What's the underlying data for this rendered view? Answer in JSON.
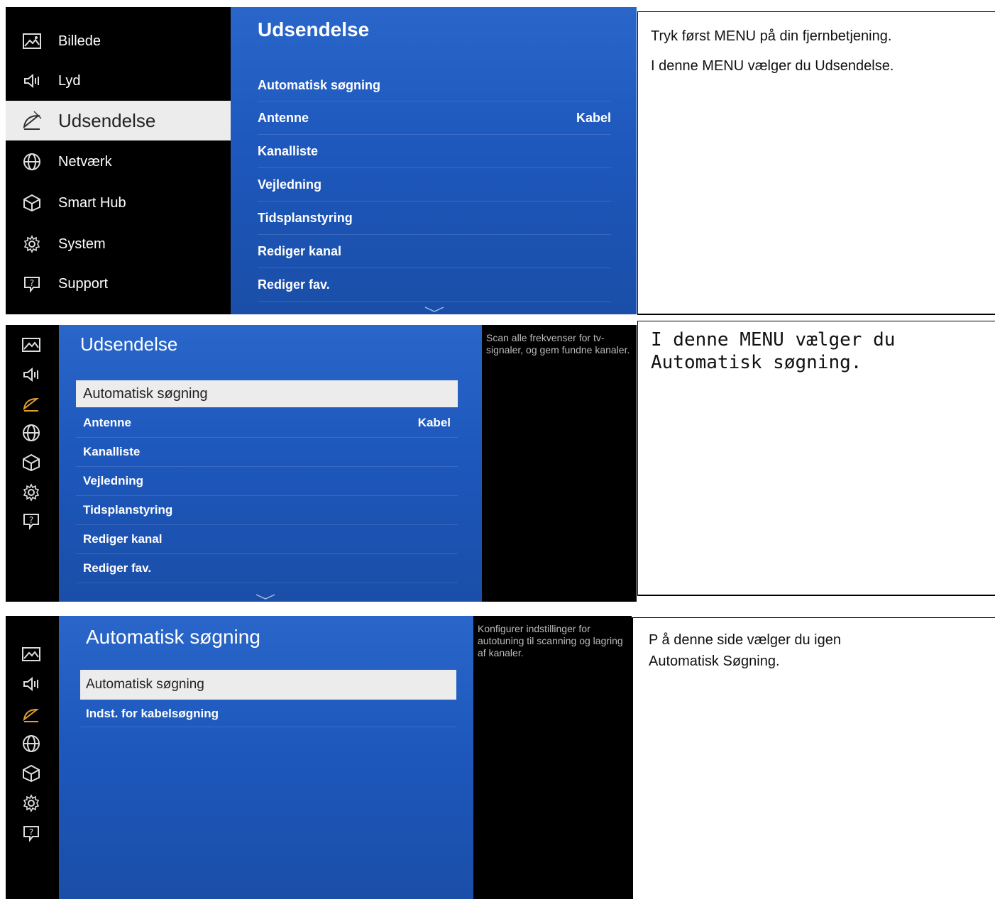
{
  "panel1": {
    "sidebar": [
      {
        "label": "Billede",
        "icon": "picture-icon"
      },
      {
        "label": "Lyd",
        "icon": "speaker-icon"
      },
      {
        "label": "Udsendelse",
        "icon": "satellite-dish-icon",
        "active": true
      },
      {
        "label": "Netværk",
        "icon": "globe-icon"
      },
      {
        "label": "Smart Hub",
        "icon": "cube-icon"
      },
      {
        "label": "System",
        "icon": "gear-icon"
      },
      {
        "label": "Support",
        "icon": "help-icon"
      }
    ],
    "title": "Udsendelse",
    "menu": [
      {
        "label": "Automatisk søgning",
        "value": ""
      },
      {
        "label": "Antenne",
        "value": "Kabel"
      },
      {
        "label": "Kanalliste",
        "value": ""
      },
      {
        "label": "Vejledning",
        "value": ""
      },
      {
        "label": "Tidsplanstyring",
        "value": ""
      },
      {
        "label": "Rediger kanal",
        "value": ""
      },
      {
        "label": "Rediger fav.",
        "value": ""
      }
    ],
    "note_line1": "Tryk først MENU på din fjernbetjening.",
    "note_line2": "I denne MENU vælger du Udsendelse."
  },
  "panel2": {
    "title": "Udsendelse",
    "menu": [
      {
        "label": "Automatisk søgning",
        "value": "",
        "selected": true
      },
      {
        "label": "Antenne",
        "value": "Kabel"
      },
      {
        "label": "Kanalliste",
        "value": ""
      },
      {
        "label": "Vejledning",
        "value": ""
      },
      {
        "label": "Tidsplanstyring",
        "value": ""
      },
      {
        "label": "Rediger kanal",
        "value": ""
      },
      {
        "label": "Rediger fav.",
        "value": ""
      }
    ],
    "description": "Scan alle frekvenser for tv-signaler, og gem fundne kanaler.",
    "note_line1": "I denne MENU vælger du",
    "note_line2": "Automatisk søgning."
  },
  "panel3": {
    "title": "Automatisk søgning",
    "menu": [
      {
        "label": "Automatisk søgning",
        "value": "",
        "selected": true
      },
      {
        "label": "Indst. for kabelsøgning",
        "value": ""
      }
    ],
    "description": "Konfigurer indstillinger for autotuning til scanning og lagring af kanaler.",
    "note_line1": "P å denne side vælger du igen",
    "note_line2": "Automatisk Søgning."
  },
  "colors": {
    "accent_icon": "#e0a030",
    "menu_blue": "#1e58bd"
  }
}
